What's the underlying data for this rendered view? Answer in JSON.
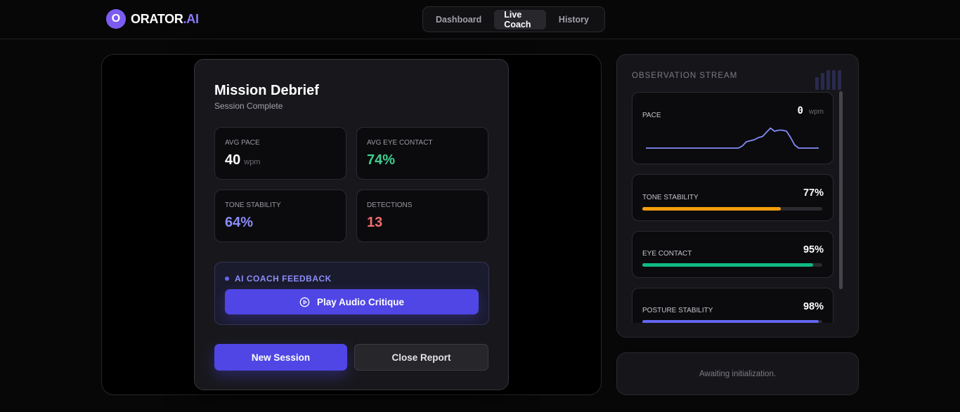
{
  "app": {
    "logo_letter": "O",
    "name_main": "ORATOR",
    "name_suffix": ".AI"
  },
  "nav": {
    "tabs": [
      {
        "label": "Dashboard",
        "active": false
      },
      {
        "label": "Live Coach",
        "active": true
      },
      {
        "label": "History",
        "active": false
      }
    ]
  },
  "debrief": {
    "title": "Mission Debrief",
    "subtitle": "Session Complete",
    "stats": {
      "pace": {
        "label": "AVG PACE",
        "value": "40",
        "unit": "wpm"
      },
      "eye_contact": {
        "label": "AVG EYE CONTACT",
        "value": "74%"
      },
      "tone": {
        "label": "TONE STABILITY",
        "value": "64%"
      },
      "detections": {
        "label": "DETECTIONS",
        "value": "13"
      }
    },
    "feedback": {
      "label": "AI COACH FEEDBACK",
      "play_label": "Play Audio Critique"
    },
    "new_session_label": "New Session",
    "close_report_label": "Close Report"
  },
  "observation": {
    "title": "OBSERVATION STREAM",
    "pace": {
      "label": "PACE",
      "value": "0",
      "unit": "wpm",
      "trace": [
        0,
        0,
        0,
        0,
        0,
        0,
        0,
        0,
        0,
        0,
        0,
        0,
        0,
        0,
        0,
        0,
        0,
        0,
        0,
        0,
        0,
        0,
        0,
        0,
        0.1,
        0.3,
        0.35,
        0.4,
        0.5,
        0.55,
        0.75,
        0.95,
        0.8,
        0.85,
        0.85,
        0.8,
        0.5,
        0.15,
        0,
        0,
        0,
        0,
        0,
        0
      ]
    },
    "metrics": [
      {
        "label": "TONE STABILITY",
        "value": "77%",
        "level": 0.77,
        "color": "#f59e0b"
      },
      {
        "label": "EYE CONTACT",
        "value": "95%",
        "level": 0.95,
        "color": "#10b981"
      },
      {
        "label": "POSTURE STABILITY",
        "value": "98%",
        "level": 0.98,
        "color": "#6366f1"
      }
    ]
  },
  "status": {
    "text": "Awaiting initialization."
  },
  "colors": {
    "accent": "#4f46e5",
    "pace_line": "#818cf8"
  }
}
